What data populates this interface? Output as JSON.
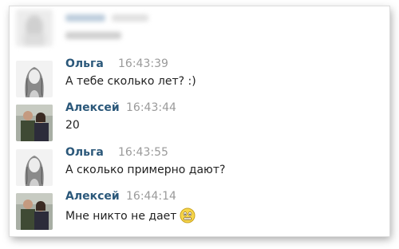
{
  "colors": {
    "name": "#2b587a",
    "time": "#9a9a9a",
    "text": "#222222"
  },
  "messages": [
    {
      "author": "Ольга",
      "time": "16:43:39",
      "text": "А тебе сколько лет? :)",
      "avatar_icon": "girl-sketch-avatar-icon"
    },
    {
      "author": "Алексей",
      "time": "16:43:44",
      "text": "20",
      "avatar_icon": "couple-photo-avatar-icon"
    },
    {
      "author": "Ольга",
      "time": "16:43:55",
      "text": "А сколько примерно дают?",
      "avatar_icon": "girl-sketch-avatar-icon"
    },
    {
      "author": "Алексей",
      "time": "16:44:14",
      "text": "Мне никто не дает",
      "avatar_icon": "couple-photo-avatar-icon",
      "emoji_icon": "worried-face-emoji-icon"
    }
  ]
}
